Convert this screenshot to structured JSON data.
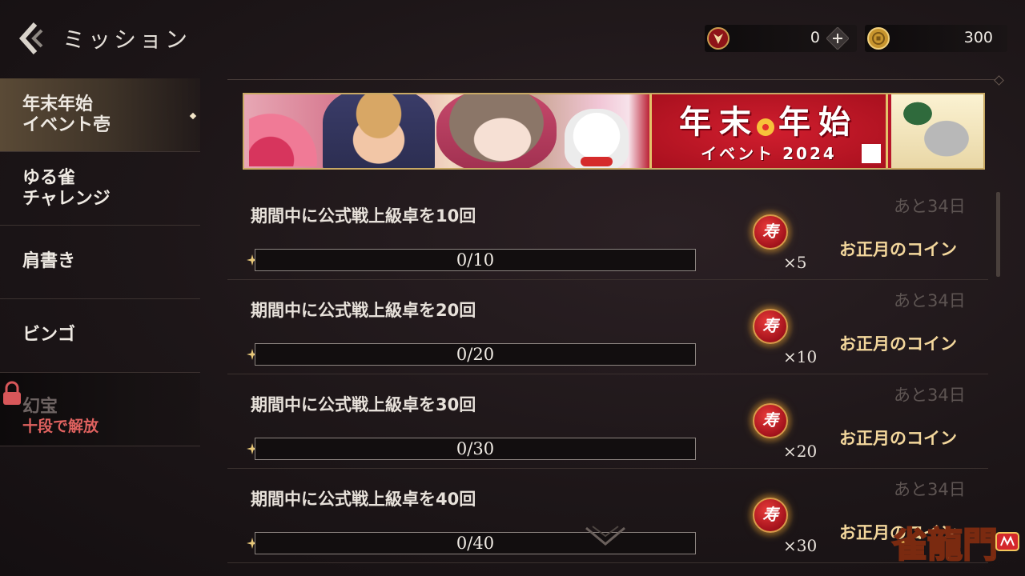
{
  "header": {
    "title": "ミッション",
    "red_currency_value": "0",
    "gold_currency_value": "300"
  },
  "sidebar": {
    "items": [
      {
        "label": "年末年始\nイベント壱"
      },
      {
        "label": "ゆる雀\nチャレンジ"
      },
      {
        "label": "肩書き"
      },
      {
        "label": "ビンゴ"
      },
      {
        "label": "幻宝",
        "lock_text": "十段で解放"
      }
    ]
  },
  "banner": {
    "title": "年末 年始",
    "subtitle": "イベント 2024"
  },
  "missions": [
    {
      "title": "期間中に公式戦上級卓を10回",
      "progress_text": "0/10",
      "progress": 0.0,
      "qty": "×5",
      "reward": "お正月のコイン",
      "days_left": "あと34日",
      "coin_glyph": "寿"
    },
    {
      "title": "期間中に公式戦上級卓を20回",
      "progress_text": "0/20",
      "progress": 0.0,
      "qty": "×10",
      "reward": "お正月のコイン",
      "days_left": "あと34日",
      "coin_glyph": "寿"
    },
    {
      "title": "期間中に公式戦上級卓を30回",
      "progress_text": "0/30",
      "progress": 0.0,
      "qty": "×20",
      "reward": "お正月のコイン",
      "days_left": "あと34日",
      "coin_glyph": "寿"
    },
    {
      "title": "期間中に公式戦上級卓を40回",
      "progress_text": "0/40",
      "progress": 0.0,
      "qty": "×30",
      "reward": "お正月のコイン",
      "days_left": "あと34日",
      "coin_glyph": "寿"
    }
  ],
  "logo_text": "雀龍門",
  "colors": {
    "accent_gold": "#c9a85e",
    "reward_text": "#f3d79c",
    "lock_red": "#e0625f",
    "banner_red": "#b7162a"
  }
}
